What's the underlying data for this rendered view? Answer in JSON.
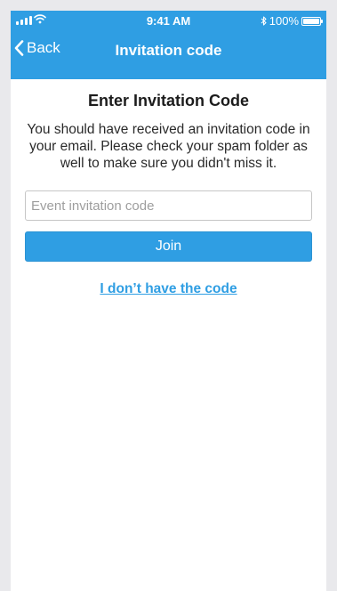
{
  "status_bar": {
    "time": "9:41 AM",
    "battery_pct": "100%",
    "battery_level": 1.0
  },
  "nav": {
    "back_label": "Back",
    "title": "Invitation code"
  },
  "main": {
    "heading": "Enter Invitation Code",
    "description": "You should have received an invitation code in your email. Please check your spam folder as well to make sure you didn't miss it.",
    "code_input": {
      "value": "",
      "placeholder": "Event invitation code"
    },
    "join_label": "Join",
    "no_code_link": "I don’t have the code"
  },
  "colors": {
    "accent": "#2f9ee3",
    "background": "#ffffff",
    "page_frame": "#e9e9ec"
  },
  "icons": {
    "signal": "signal-icon",
    "wifi": "wifi-icon",
    "bluetooth": "bluetooth-icon",
    "battery": "battery-icon",
    "back": "chevron-left-icon"
  }
}
